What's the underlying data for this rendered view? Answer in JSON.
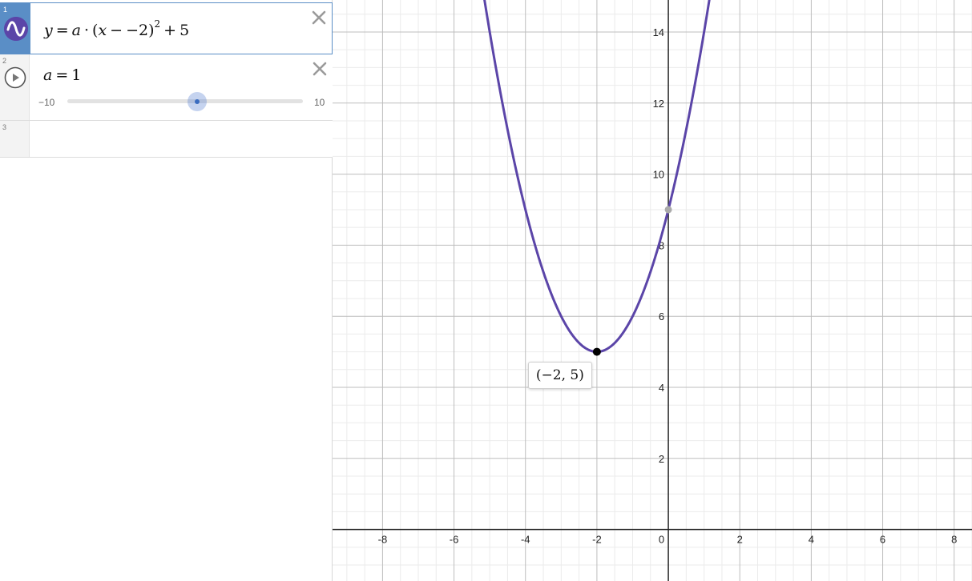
{
  "expressions": [
    {
      "index": "1",
      "icon": "graph-wave-icon",
      "formula": {
        "lhs": "y",
        "eq": "=",
        "a": "a",
        "dot": "·",
        "open": "(",
        "x": "x",
        "minus": "−",
        "h": "−2",
        "close": ")",
        "power": "2",
        "plus": "+",
        "k": "5"
      }
    },
    {
      "index": "2",
      "icon": "play-icon",
      "name": "a",
      "eq": "=",
      "value": "1",
      "slider": {
        "min_label": "−10",
        "max_label": "10",
        "min": -10,
        "max": 10,
        "value": 1
      }
    },
    {
      "index": "3"
    }
  ],
  "close_glyph": "×",
  "vertex_label": "(−2, 5)",
  "colors": {
    "curve": "#5b45a8",
    "accent": "#5a8ec6",
    "point": "#000000",
    "intercept": "#aaaaaa"
  },
  "chart_data": {
    "type": "line",
    "function": "y = 1*(x+2)^2 + 5",
    "xlim": [
      -9.4,
      8.5
    ],
    "ylim": [
      -1.45,
      14.9
    ],
    "x_ticks": [
      -8,
      -6,
      -4,
      -2,
      2,
      4,
      6,
      8
    ],
    "y_ticks": [
      2,
      4,
      6,
      8,
      10,
      12,
      14
    ],
    "origin_label": "0",
    "grid": true,
    "vertex": {
      "x": -2,
      "y": 5
    },
    "y_intercept": {
      "x": 0,
      "y": 9
    }
  }
}
